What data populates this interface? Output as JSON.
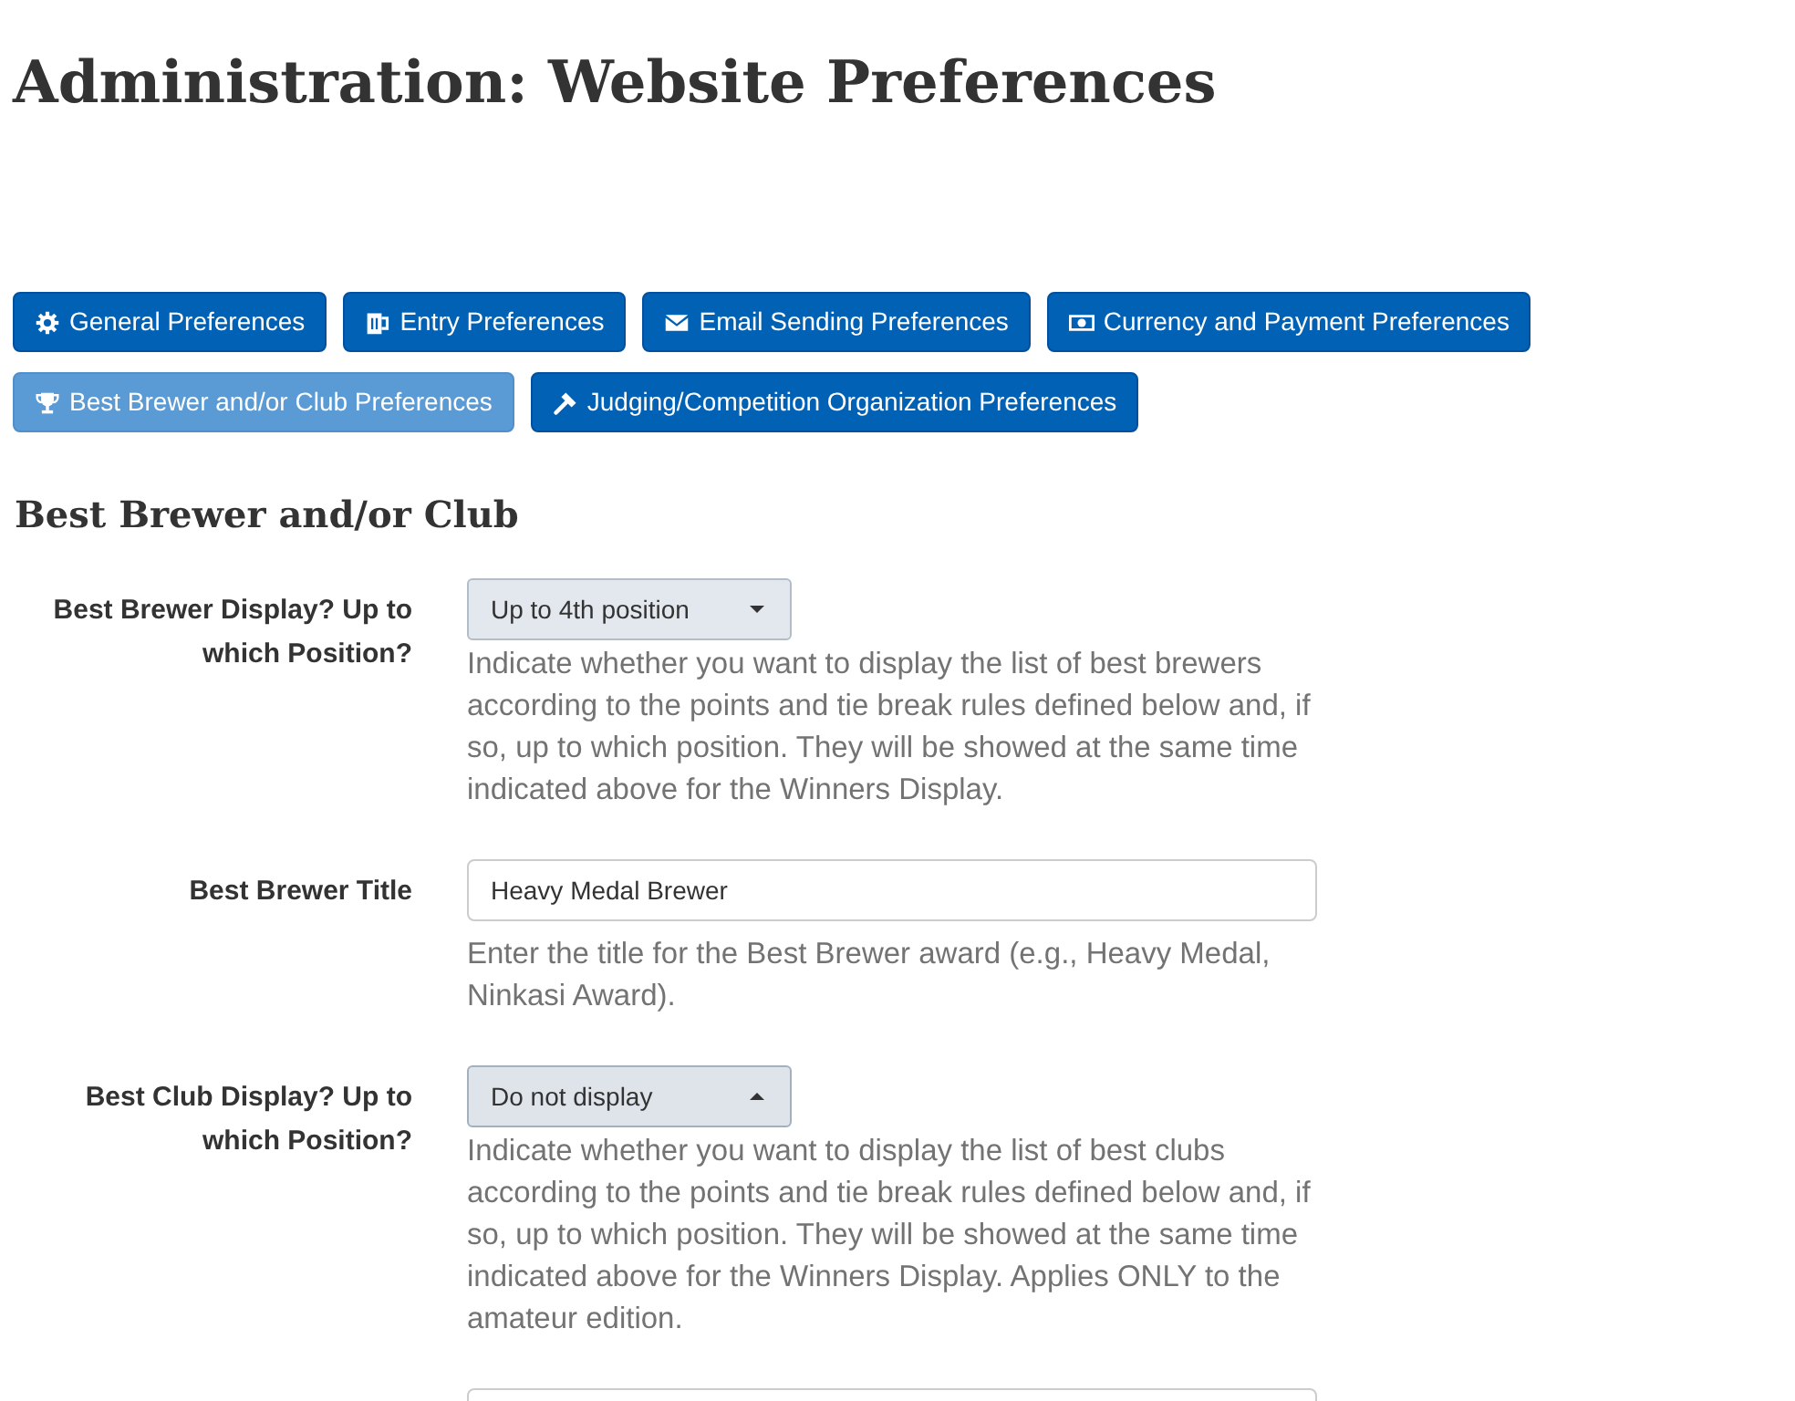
{
  "page": {
    "title": "Administration: Website Preferences"
  },
  "tabs": [
    {
      "label": "General Preferences",
      "selected": false
    },
    {
      "label": "Entry Preferences",
      "selected": false
    },
    {
      "label": "Email Sending Preferences",
      "selected": false
    },
    {
      "label": "Currency and Payment Preferences",
      "selected": false
    },
    {
      "label": "Best Brewer and/or Club Preferences",
      "selected": true
    },
    {
      "label": "Judging/Competition Organization Preferences",
      "selected": false
    }
  ],
  "section": {
    "title": "Best Brewer and/or Club",
    "fields": [
      {
        "kind": "select",
        "label": "Best Brewer Display? Up to which Position?",
        "value": "Up to 4th position",
        "expanded": false,
        "help": "Indicate whether you want to display the list of best brewers according to the points and tie break rules defined below and, if so, up to which position. They will be showed at the same time indicated above for the Winners Display."
      },
      {
        "kind": "text",
        "label": "Best Brewer Title",
        "value": "Heavy Medal Brewer",
        "help": "Enter the title for the Best Brewer award (e.g., Heavy Medal, Ninkasi Award)."
      },
      {
        "kind": "select",
        "label": "Best Club Display? Up to which Position?",
        "value": "Do not display",
        "expanded": true,
        "help": "Indicate whether you want to display the list of best clubs according to the points and tie break rules defined below and, if so, up to which position. They will be showed at the same time indicated above for the Winners Display. Applies ONLY to the amateur edition."
      },
      {
        "kind": "text"
      }
    ]
  }
}
